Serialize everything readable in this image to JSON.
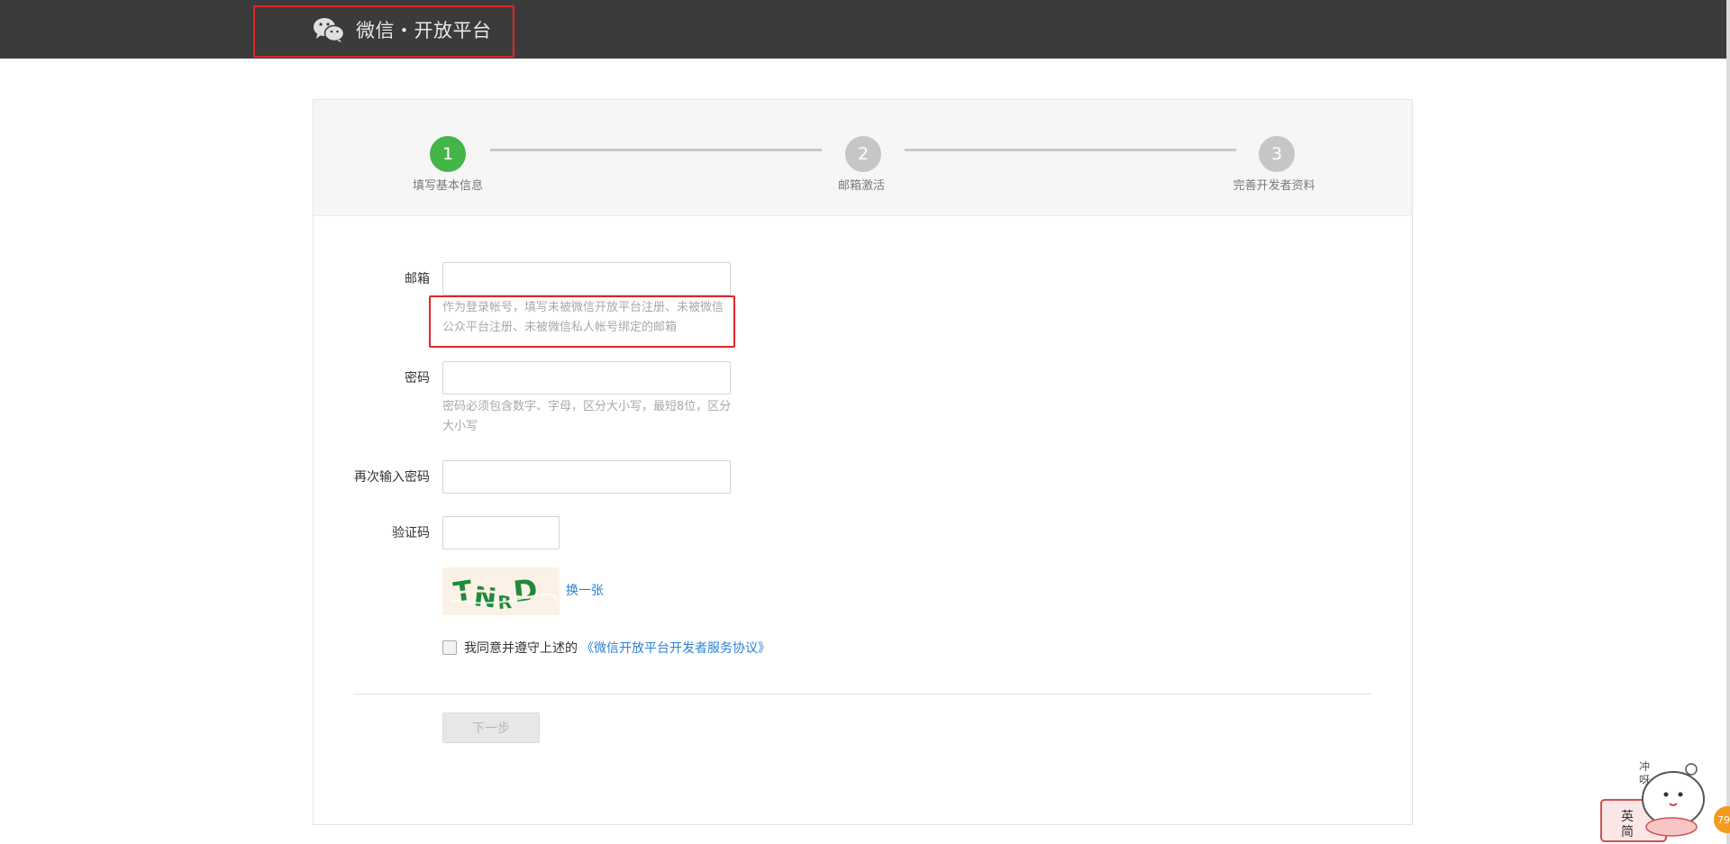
{
  "header": {
    "title": "微信・开放平台",
    "logo_icon": "wechat-logo-icon",
    "background_color": "#3b3b3b"
  },
  "steps": [
    {
      "number": "1",
      "label": "填写基本信息",
      "state": "active"
    },
    {
      "number": "2",
      "label": "邮箱激活",
      "state": "pending"
    },
    {
      "number": "3",
      "label": "完善开发者资料",
      "state": "pending"
    }
  ],
  "form": {
    "email": {
      "label": "邮箱",
      "value": "",
      "hint": "作为登录帐号，填写未被微信开放平台注册、未被微信公众平台注册、未被微信私人帐号绑定的邮箱"
    },
    "password": {
      "label": "密码",
      "value": "",
      "hint": "密码必须包含数字、字母，区分大小写，最短8位，区分大小写"
    },
    "confirm_password": {
      "label": "再次输入密码",
      "value": ""
    },
    "captcha": {
      "label": "验证码",
      "value": "",
      "image_text": "TNRD",
      "refresh_label": "换一张"
    }
  },
  "agreement": {
    "text": "我同意并遵守上述的",
    "link": "《微信开放平台开发者服务协议》",
    "checked": false
  },
  "next_button": {
    "label": "下一步",
    "enabled": false
  },
  "widget": {
    "chars": [
      "冲",
      "呀",
      "英",
      "简"
    ],
    "badge": "79"
  },
  "colors": {
    "active_step": "#44b549",
    "pending_step": "#c6c6c6",
    "link": "#2a82d4",
    "highlight_box": "#e0262a"
  }
}
